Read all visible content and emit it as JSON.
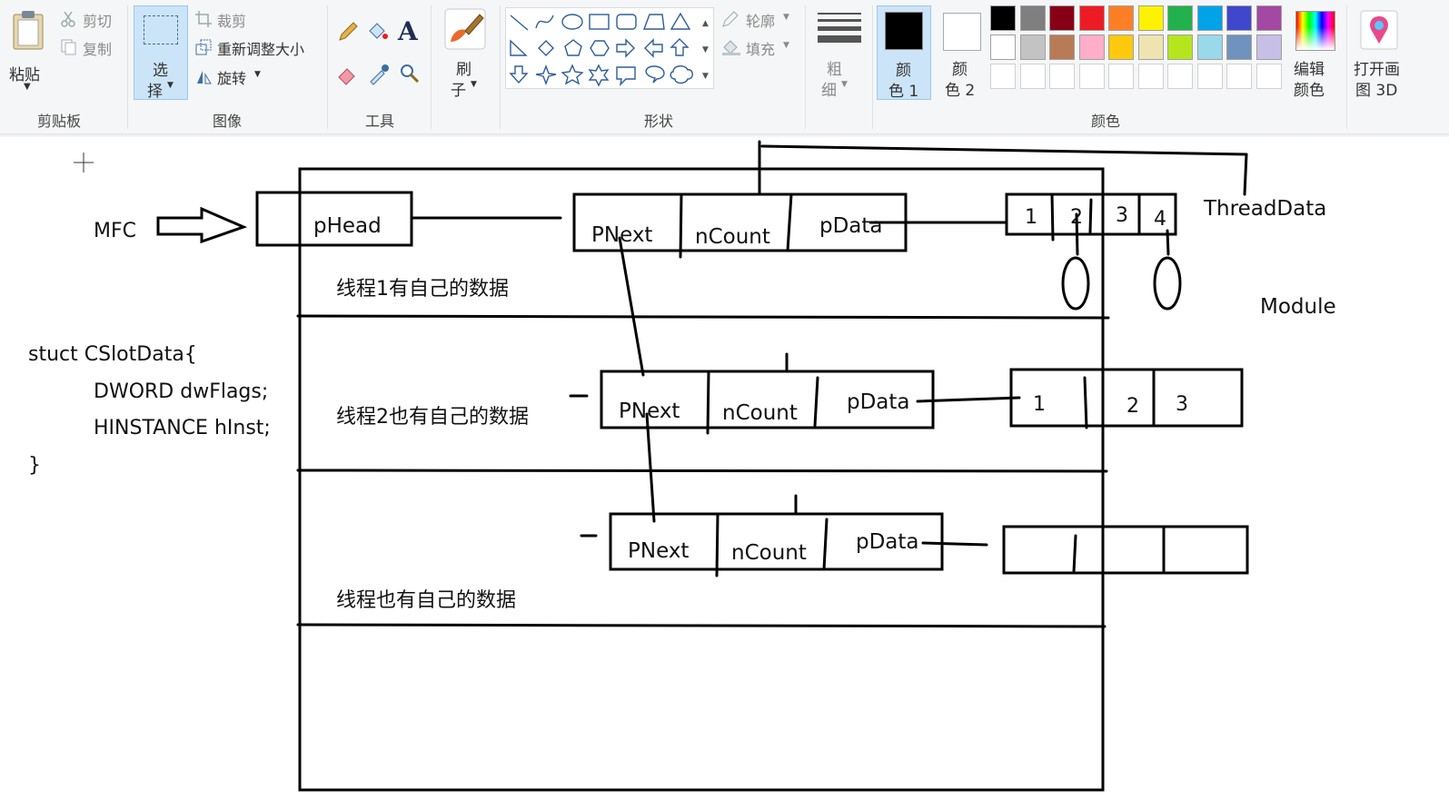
{
  "ribbon": {
    "clipboard": {
      "paste_label": "粘贴",
      "cut_label": "剪切",
      "copy_label": "复制",
      "group_label": "剪贴板"
    },
    "image": {
      "select_label_1": "选",
      "select_label_2": "择",
      "crop_label": "裁剪",
      "resize_label": "重新调整大小",
      "rotate_label": "旋转",
      "group_label": "图像"
    },
    "tools": {
      "group_label": "工具"
    },
    "brushes": {
      "label_1": "刷",
      "label_2": "子"
    },
    "shapes": {
      "outline_label": "轮廓",
      "fill_label": "填充",
      "group_label": "形状"
    },
    "size": {
      "label_1": "粗",
      "label_2": "细"
    },
    "colors": {
      "color1_label_1": "颜",
      "color1_label_2": "色 1",
      "color2_label_1": "颜",
      "color2_label_2": "色 2",
      "edit_colors_1": "编辑",
      "edit_colors_2": "颜色",
      "group_label": "颜色",
      "color1_value": "#000000",
      "color2_value": "#ffffff",
      "palette_row1": [
        "#000000",
        "#7f7f7f",
        "#880015",
        "#ed1c24",
        "#ff7f27",
        "#fff200",
        "#22b14c",
        "#00a2e8",
        "#3f48cc",
        "#a349a4"
      ],
      "palette_row2": [
        "#ffffff",
        "#c3c3c3",
        "#b97a57",
        "#ffaec9",
        "#ffc90e",
        "#efe4b0",
        "#b5e61d",
        "#99d9ea",
        "#7092be",
        "#c8bfe7"
      ]
    },
    "paint3d": {
      "label_1": "打开画",
      "label_2": "图 3D"
    }
  },
  "canvas": {
    "mfc_label": "MFC",
    "phead_label": "pHead",
    "threaddata_label": "ThreadData",
    "module_label": "Module",
    "thread1_text": "线程1有自己的数据",
    "thread2_text": "线程2也有自己的数据",
    "thread3_text": "线程也有自己的数据",
    "struct_lines": [
      "stuct CSlotData{",
      "DWORD dwFlags;",
      "HINSTANCE hInst;",
      "}"
    ],
    "node1": {
      "pnext": "PNext",
      "ncount": "nCount",
      "pdata": "pData"
    },
    "node2": {
      "pnext": "PNext",
      "ncount": "nCount",
      "pdata": "pData"
    },
    "node3": {
      "pnext": "PNext",
      "ncount": "nCount",
      "pdata": "pData"
    },
    "array1": [
      "1",
      "2",
      "3",
      "4"
    ],
    "array2": [
      "1",
      "2",
      "3"
    ]
  }
}
